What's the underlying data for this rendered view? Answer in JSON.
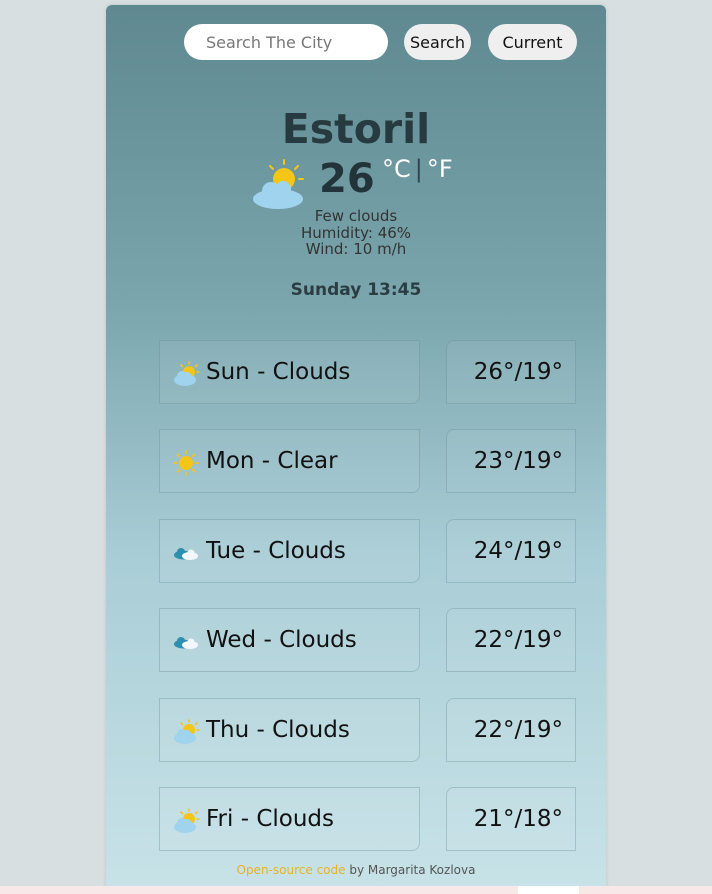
{
  "search": {
    "placeholder": "Search The City",
    "button_label": "Search",
    "current_label": "Current"
  },
  "current": {
    "city": "Estoril",
    "temp": "26",
    "unit_c": "°C",
    "unit_sep": "|",
    "unit_f": "°F",
    "description": "Few clouds",
    "humidity": "Humidity: 46%",
    "wind": "Wind: 10 m/h",
    "datetime": "Sunday 13:45",
    "icon": "few-clouds-icon"
  },
  "forecast": [
    {
      "label": "Sun - Clouds",
      "temps": "26°/19°",
      "icon": "sun-cloud-icon"
    },
    {
      "label": "Mon - Clear",
      "temps": "23°/19°",
      "icon": "sun-icon"
    },
    {
      "label": "Tue - Clouds",
      "temps": "24°/19°",
      "icon": "clouds-icon"
    },
    {
      "label": "Wed - Clouds",
      "temps": "22°/19°",
      "icon": "clouds-icon"
    },
    {
      "label": "Thu - Clouds",
      "temps": "22°/19°",
      "icon": "sun-cloud-icon"
    },
    {
      "label": "Fri - Clouds",
      "temps": "21°/18°",
      "icon": "sun-cloud-icon"
    }
  ],
  "footer": {
    "link_text": "Open-source code",
    "by_text": " by Margarita Kozlova"
  },
  "colors": {
    "link": "#e6b325",
    "card_top": "#5f8890",
    "card_bottom": "#c8e3e8"
  }
}
